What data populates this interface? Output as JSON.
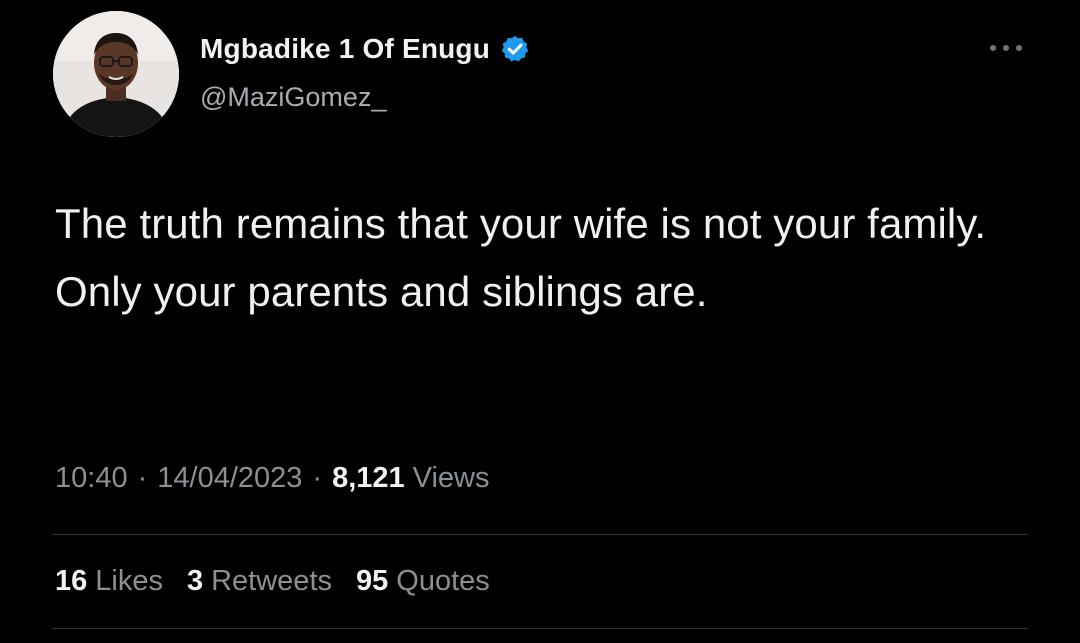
{
  "author": {
    "display_name": "Mgbadike 1 Of Enugu",
    "handle": "@MaziGomez_",
    "verified_icon": "verified-badge-icon",
    "avatar_icon": "avatar-photo"
  },
  "tweet": {
    "text": "The truth remains that your wife is not your family. Only your parents and siblings are."
  },
  "meta": {
    "time": "10:40",
    "separator": "·",
    "date": "14/04/2023",
    "views_count": "8,121",
    "views_label": "Views"
  },
  "stats": {
    "likes_count": "16",
    "likes_label": "Likes",
    "retweets_count": "3",
    "retweets_label": "Retweets",
    "quotes_count": "95",
    "quotes_label": "Quotes"
  },
  "menu": {
    "icon": "more-options-icon"
  },
  "colors": {
    "background": "#000000",
    "text_primary": "#f2f2f2",
    "text_secondary": "#8b9095",
    "verified_blue": "#1d9bf0",
    "divider": "#2f3336"
  }
}
